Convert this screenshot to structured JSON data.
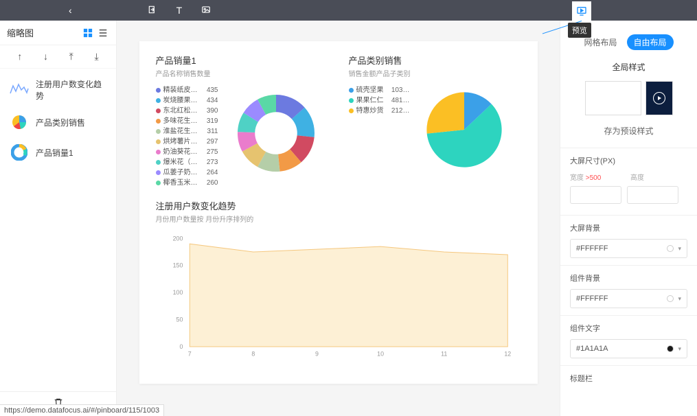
{
  "topbar": {
    "preview_tooltip": "预览"
  },
  "sidebar": {
    "title": "缩略图",
    "thumbs": [
      {
        "label": "注册用户数变化趋势"
      },
      {
        "label": "产品类别销售"
      },
      {
        "label": "产品销量1"
      }
    ]
  },
  "right": {
    "tabs": {
      "grid": "网格布局",
      "free": "自由布局"
    },
    "global_style": "全局样式",
    "preset_label": "存为预设样式",
    "dim_label": "大屏尺寸(PX)",
    "dim_width_label": "宽度",
    "dim_width_warn": ">500",
    "dim_height_label": "高度",
    "bg_label": "大屏背景",
    "bg_value": "#FFFFFF",
    "comp_bg_label": "组件背景",
    "comp_bg_value": "#FFFFFF",
    "comp_text_label": "组件文字",
    "comp_text_value": "#1A1A1A",
    "titlebar_label": "标题栏"
  },
  "charts": {
    "donut": {
      "title": "产品销量1",
      "subtitle": "产品名称销售数量"
    },
    "pie": {
      "title": "产品类别销售",
      "subtitle": "销售金额产品子类别"
    },
    "area": {
      "title": "注册用户数变化趋势",
      "subtitle": "月份用户数量按 月份升序排列的"
    }
  },
  "chart_data": [
    {
      "type": "pie",
      "id": "donut",
      "title": "产品销量1",
      "subtitle": "产品名称销售数量",
      "series": [
        {
          "name": "精装纸皮…",
          "value": 435,
          "color": "#6c7ae0"
        },
        {
          "name": "炭烧腰果1…",
          "value": 434,
          "color": "#3fb1e3"
        },
        {
          "name": "东北红松…",
          "value": 390,
          "color": "#d14a61"
        },
        {
          "name": "多味花生1…",
          "value": 319,
          "color": "#f29a46"
        },
        {
          "name": "淮盐花生…",
          "value": 311,
          "color": "#b5cea8"
        },
        {
          "name": "烘烤薯片…",
          "value": 297,
          "color": "#e6c36f"
        },
        {
          "name": "奶油葵花…",
          "value": 275,
          "color": "#ea7ccc"
        },
        {
          "name": "爆米花（…",
          "value": 273,
          "color": "#4fd1c5"
        },
        {
          "name": "瓜蒌子奶…",
          "value": 264,
          "color": "#9b8bff"
        },
        {
          "name": "椰香玉米6…",
          "value": 260,
          "color": "#5ad8a6"
        }
      ]
    },
    {
      "type": "pie",
      "id": "pie",
      "title": "产品类别销售",
      "subtitle": "销售金额产品子类别",
      "series": [
        {
          "name": "硫壳坚果",
          "value": 103,
          "display": "103…",
          "color": "#3ba0e8"
        },
        {
          "name": "果果仁仁",
          "value": 481,
          "display": "481…",
          "color": "#2dd4bf"
        },
        {
          "name": "特惠炒货",
          "value": 212,
          "display": "212…",
          "color": "#fbbf24"
        }
      ]
    },
    {
      "type": "area",
      "id": "area",
      "title": "注册用户数变化趋势",
      "subtitle": "月份用户数量按 月份升序排列的",
      "x": [
        7,
        8,
        9,
        10,
        11,
        12
      ],
      "y": [
        190,
        175,
        180,
        185,
        175,
        170
      ],
      "ylim": [
        0,
        200
      ],
      "yTicks": [
        0,
        50,
        100,
        150,
        200
      ],
      "color": "#f5c77e"
    }
  ],
  "status_url": "https://demo.datafocus.ai/#/pinboard/115/1003"
}
